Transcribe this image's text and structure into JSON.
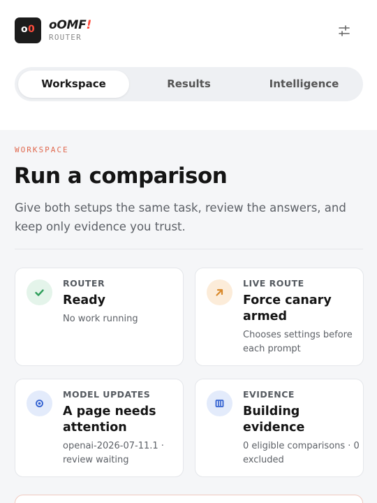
{
  "brand": {
    "logo_o": "o",
    "logo_zero": "0",
    "name": "oOMF",
    "bang": "!",
    "sub": "ROUTER"
  },
  "header": {
    "settings_icon": "sliders-icon"
  },
  "tabs": [
    {
      "label": "Workspace",
      "active": true
    },
    {
      "label": "Results",
      "active": false
    },
    {
      "label": "Intelligence",
      "active": false
    }
  ],
  "page": {
    "eyebrow": "WORKSPACE",
    "title": "Run a comparison",
    "lede": "Give both setups the same task, review the answers, and keep only evidence you trust."
  },
  "cards": [
    {
      "icon": "check-icon",
      "label": "ROUTER",
      "value": "Ready",
      "sub": "No work running"
    },
    {
      "icon": "arrow-up-right-icon",
      "label": "LIVE ROUTE",
      "value": "Force canary armed",
      "sub": "Chooses settings before each prompt"
    },
    {
      "icon": "target-icon",
      "label": "MODEL UPDATES",
      "value": "A page needs attention",
      "sub": "openai-2026-07-11.1 · review waiting"
    },
    {
      "icon": "columns-icon",
      "label": "EVIDENCE",
      "value": "Building evidence",
      "sub": "0 eligible comparisons · 0 excluded"
    }
  ],
  "colors": {
    "accent": "#ff4d3d",
    "eyebrow": "#e0694f",
    "green": "#2f9e5b",
    "amber": "#d9892b",
    "blue": "#2f5fd0"
  }
}
